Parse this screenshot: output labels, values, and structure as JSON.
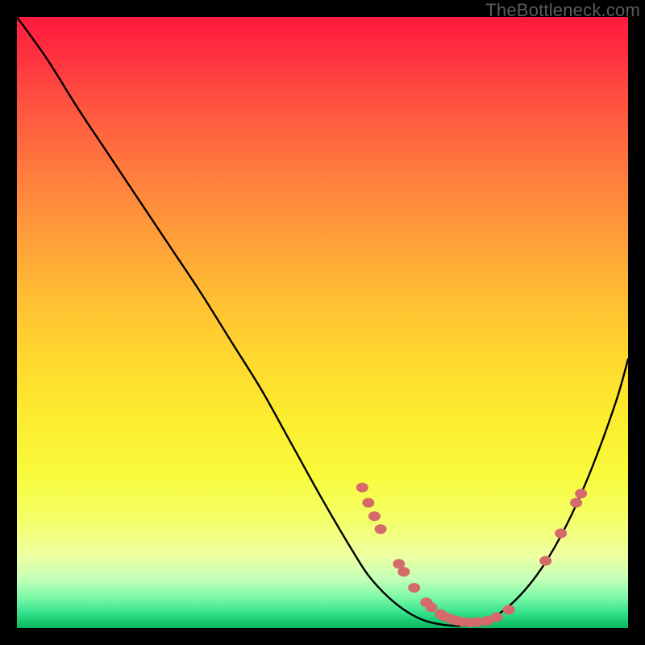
{
  "watermark": "TheBottleneck.com",
  "chart_data": {
    "type": "line",
    "title": "",
    "xlabel": "",
    "ylabel": "",
    "xlim": [
      0,
      100
    ],
    "ylim": [
      0,
      100
    ],
    "grid": false,
    "curve": {
      "name": "bottleneck-curve",
      "x": [
        0,
        5,
        10,
        15,
        20,
        25,
        30,
        35,
        40,
        45,
        50,
        55,
        58,
        62,
        66,
        70,
        74,
        78,
        82,
        86,
        90,
        94,
        98,
        100
      ],
      "y": [
        100,
        93,
        85,
        77.5,
        70,
        62.5,
        55,
        47,
        39,
        30,
        21,
        12.5,
        8,
        4,
        1.5,
        0.5,
        0.5,
        1.8,
        5,
        10,
        17,
        26,
        37,
        44
      ]
    },
    "markers": {
      "name": "highlighted-points",
      "color": "#d46a6a",
      "points": [
        {
          "x": 56.5,
          "y": 23.0
        },
        {
          "x": 57.5,
          "y": 20.5
        },
        {
          "x": 58.5,
          "y": 18.3
        },
        {
          "x": 59.5,
          "y": 16.2
        },
        {
          "x": 62.5,
          "y": 10.5
        },
        {
          "x": 63.3,
          "y": 9.2
        },
        {
          "x": 65.0,
          "y": 6.6
        },
        {
          "x": 67.0,
          "y": 4.2
        },
        {
          "x": 67.8,
          "y": 3.4
        },
        {
          "x": 69.3,
          "y": 2.3
        },
        {
          "x": 70.0,
          "y": 1.9
        },
        {
          "x": 71.0,
          "y": 1.5
        },
        {
          "x": 72.0,
          "y": 1.2
        },
        {
          "x": 73.0,
          "y": 1.0
        },
        {
          "x": 74.2,
          "y": 0.9
        },
        {
          "x": 75.5,
          "y": 1.0
        },
        {
          "x": 77.0,
          "y": 1.2
        },
        {
          "x": 78.5,
          "y": 1.8
        },
        {
          "x": 80.5,
          "y": 3.0
        },
        {
          "x": 86.5,
          "y": 11.0
        },
        {
          "x": 89.0,
          "y": 15.5
        },
        {
          "x": 91.5,
          "y": 20.5
        },
        {
          "x": 92.3,
          "y": 22.0
        }
      ]
    }
  }
}
